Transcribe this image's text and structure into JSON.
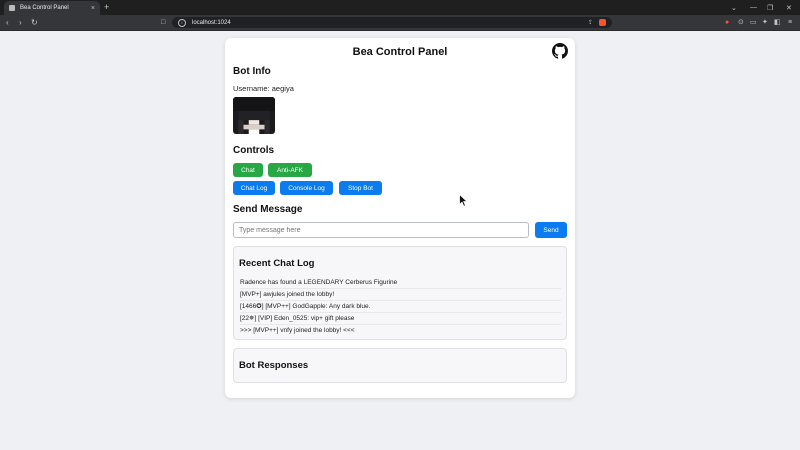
{
  "browser": {
    "tab_title": "Bea Control Panel",
    "tab_close": "×",
    "new_tab": "+",
    "url": "localhost:1024",
    "back": "‹",
    "forward": "›",
    "reload": "↻",
    "bookmark": "□",
    "window_controls": [
      "⌄",
      "—",
      "❐",
      "✕"
    ]
  },
  "page": {
    "title": "Bea Control Panel",
    "bot_info": {
      "heading": "Bot Info",
      "username_label": "Username: aegiya"
    },
    "controls": {
      "heading": "Controls",
      "row1": [
        "Chat",
        "Anti-AFK"
      ],
      "row2": [
        "Chat Log",
        "Console Log",
        "Stop Bot"
      ]
    },
    "send_message": {
      "heading": "Send Message",
      "placeholder": "Type message here",
      "send_label": "Send"
    },
    "chat_log": {
      "heading": "Recent Chat Log",
      "lines": [
        "Radence has found a LEGENDARY Cerberus Figurine",
        "[MVP+] awjules joined the lobby!",
        "[1466✪] [MVP++] GodGapple: Any dark blue.",
        "[22✵] [VIP] Eden_0525: vip+ gift please",
        ">>> [MVP++] vnfy joined the lobby! <<<"
      ]
    },
    "bot_responses": {
      "heading": "Bot Responses"
    }
  },
  "colors": {
    "green_button": "#28a745",
    "blue_button": "#0b7bf0",
    "background": "#eef0f3"
  },
  "icons": [
    "github-icon",
    "info-icon",
    "share-icon",
    "brave-shield-icon",
    "mouse-cursor-icon"
  ]
}
